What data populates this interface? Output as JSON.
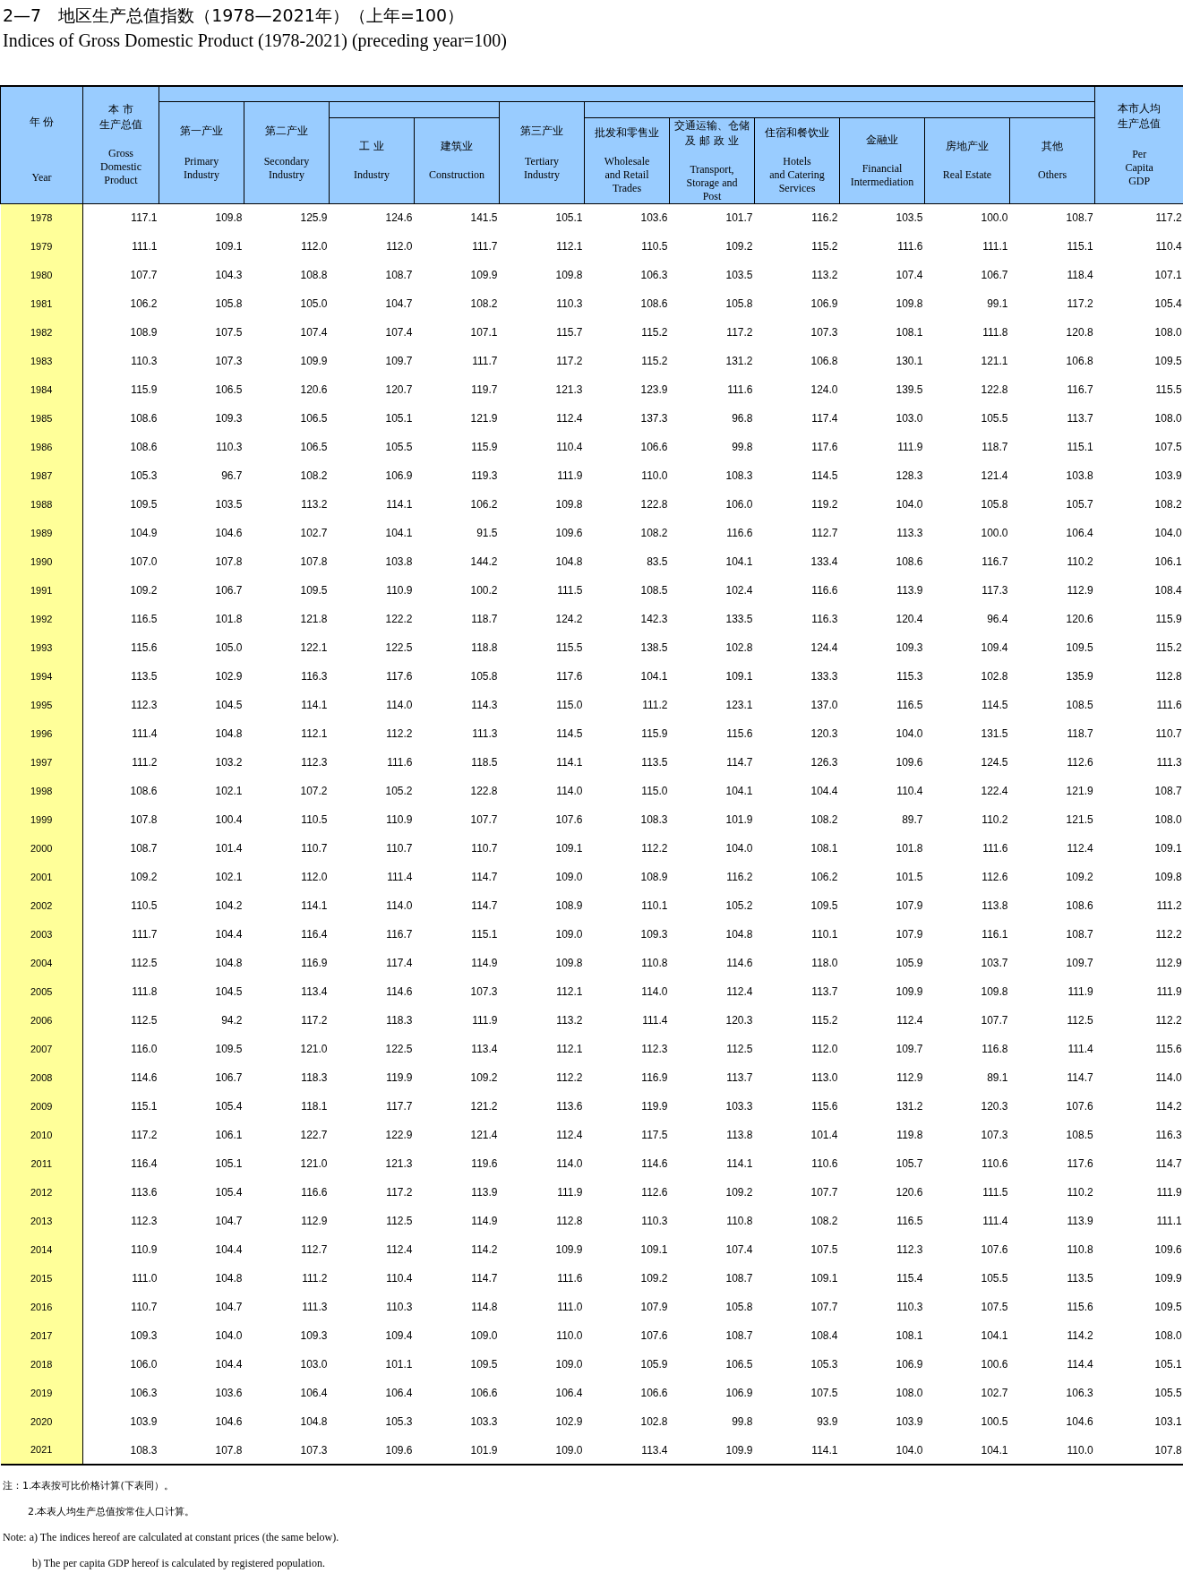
{
  "title": "2—7　地区生产总值指数（1978—2021年）（上年=100）",
  "subtitle": "Indices of Gross Domestic Product (1978-2021) (preceding year=100)",
  "columns": [
    {
      "zh": [
        "年 份"
      ],
      "en": [
        "Year"
      ]
    },
    {
      "zh": [
        "本 市",
        "生产总值"
      ],
      "en": [
        "Gross",
        "Domestic",
        "Product"
      ]
    },
    {
      "zh": [
        "第一产业"
      ],
      "en": [
        "Primary",
        "Industry"
      ]
    },
    {
      "zh": [
        "第二产业"
      ],
      "en": [
        "Secondary",
        "Industry"
      ]
    },
    {
      "zh": [
        "工 业"
      ],
      "en": [
        "Industry"
      ]
    },
    {
      "zh": [
        "建筑业"
      ],
      "en": [
        "Construction"
      ]
    },
    {
      "zh": [
        "第三产业"
      ],
      "en": [
        "Tertiary",
        "Industry"
      ]
    },
    {
      "zh": [
        "批发和零售业"
      ],
      "en": [
        "Wholesale",
        "and Retail",
        "Trades"
      ]
    },
    {
      "zh": [
        "交通运输、仓储",
        "及 邮 政 业"
      ],
      "en": [
        "Transport,",
        "Storage and",
        "Post"
      ]
    },
    {
      "zh": [
        "住宿和餐饮业"
      ],
      "en": [
        "Hotels",
        "and Catering",
        "Services"
      ]
    },
    {
      "zh": [
        "金融业"
      ],
      "en": [
        "Financial",
        "Intermediation"
      ]
    },
    {
      "zh": [
        "房地产业"
      ],
      "en": [
        "Real Estate"
      ]
    },
    {
      "zh": [
        "其他"
      ],
      "en": [
        "Others"
      ]
    },
    {
      "zh": [
        "本市人均",
        "生产总值"
      ],
      "en": [
        "Per",
        "Capita",
        "GDP"
      ]
    }
  ],
  "rows": [
    {
      "year": "1978",
      "values": [
        "117.1",
        "109.8",
        "125.9",
        "124.6",
        "141.5",
        "105.1",
        "103.6",
        "101.7",
        "116.2",
        "103.5",
        "100.0",
        "108.7",
        "117.2"
      ]
    },
    {
      "year": "1979",
      "values": [
        "111.1",
        "109.1",
        "112.0",
        "112.0",
        "111.7",
        "112.1",
        "110.5",
        "109.2",
        "115.2",
        "111.6",
        "111.1",
        "115.1",
        "110.4"
      ]
    },
    {
      "year": "1980",
      "values": [
        "107.7",
        "104.3",
        "108.8",
        "108.7",
        "109.9",
        "109.8",
        "106.3",
        "103.5",
        "113.2",
        "107.4",
        "106.7",
        "118.4",
        "107.1"
      ]
    },
    {
      "year": "1981",
      "values": [
        "106.2",
        "105.8",
        "105.0",
        "104.7",
        "108.2",
        "110.3",
        "108.6",
        "105.8",
        "106.9",
        "109.8",
        "99.1",
        "117.2",
        "105.4"
      ]
    },
    {
      "year": "1982",
      "values": [
        "108.9",
        "107.5",
        "107.4",
        "107.4",
        "107.1",
        "115.7",
        "115.2",
        "117.2",
        "107.3",
        "108.1",
        "111.8",
        "120.8",
        "108.0"
      ]
    },
    {
      "year": "1983",
      "values": [
        "110.3",
        "107.3",
        "109.9",
        "109.7",
        "111.7",
        "117.2",
        "115.2",
        "131.2",
        "106.8",
        "130.1",
        "121.1",
        "106.8",
        "109.5"
      ]
    },
    {
      "year": "1984",
      "values": [
        "115.9",
        "106.5",
        "120.6",
        "120.7",
        "119.7",
        "121.3",
        "123.9",
        "111.6",
        "124.0",
        "139.5",
        "122.8",
        "116.7",
        "115.5"
      ]
    },
    {
      "year": "1985",
      "values": [
        "108.6",
        "109.3",
        "106.5",
        "105.1",
        "121.9",
        "112.4",
        "137.3",
        "96.8",
        "117.4",
        "103.0",
        "105.5",
        "113.7",
        "108.0"
      ]
    },
    {
      "year": "1986",
      "values": [
        "108.6",
        "110.3",
        "106.5",
        "105.5",
        "115.9",
        "110.4",
        "106.6",
        "99.8",
        "117.6",
        "111.9",
        "118.7",
        "115.1",
        "107.5"
      ]
    },
    {
      "year": "1987",
      "values": [
        "105.3",
        "96.7",
        "108.2",
        "106.9",
        "119.3",
        "111.9",
        "110.0",
        "108.3",
        "114.5",
        "128.3",
        "121.4",
        "103.8",
        "103.9"
      ]
    },
    {
      "year": "1988",
      "values": [
        "109.5",
        "103.5",
        "113.2",
        "114.1",
        "106.2",
        "109.8",
        "122.8",
        "106.0",
        "119.2",
        "104.0",
        "105.8",
        "105.7",
        "108.2"
      ]
    },
    {
      "year": "1989",
      "values": [
        "104.9",
        "104.6",
        "102.7",
        "104.1",
        "91.5",
        "109.6",
        "108.2",
        "116.6",
        "112.7",
        "113.3",
        "100.0",
        "106.4",
        "104.0"
      ]
    },
    {
      "year": "1990",
      "values": [
        "107.0",
        "107.8",
        "107.8",
        "103.8",
        "144.2",
        "104.8",
        "83.5",
        "104.1",
        "133.4",
        "108.6",
        "116.7",
        "110.2",
        "106.1"
      ]
    },
    {
      "year": "1991",
      "values": [
        "109.2",
        "106.7",
        "109.5",
        "110.9",
        "100.2",
        "111.5",
        "108.5",
        "102.4",
        "116.6",
        "113.9",
        "117.3",
        "112.9",
        "108.4"
      ]
    },
    {
      "year": "1992",
      "values": [
        "116.5",
        "101.8",
        "121.8",
        "122.2",
        "118.7",
        "124.2",
        "142.3",
        "133.5",
        "116.3",
        "120.4",
        "96.4",
        "120.6",
        "115.9"
      ]
    },
    {
      "year": "1993",
      "values": [
        "115.6",
        "105.0",
        "122.1",
        "122.5",
        "118.8",
        "115.5",
        "138.5",
        "102.8",
        "124.4",
        "109.3",
        "109.4",
        "109.5",
        "115.2"
      ]
    },
    {
      "year": "1994",
      "values": [
        "113.5",
        "102.9",
        "116.3",
        "117.6",
        "105.8",
        "117.6",
        "104.1",
        "109.1",
        "133.3",
        "115.3",
        "102.8",
        "135.9",
        "112.8"
      ]
    },
    {
      "year": "1995",
      "values": [
        "112.3",
        "104.5",
        "114.1",
        "114.0",
        "114.3",
        "115.0",
        "111.2",
        "123.1",
        "137.0",
        "116.5",
        "114.5",
        "108.5",
        "111.6"
      ]
    },
    {
      "year": "1996",
      "values": [
        "111.4",
        "104.8",
        "112.1",
        "112.2",
        "111.3",
        "114.5",
        "115.9",
        "115.6",
        "120.3",
        "104.0",
        "131.5",
        "118.7",
        "110.7"
      ]
    },
    {
      "year": "1997",
      "values": [
        "111.2",
        "103.2",
        "112.3",
        "111.6",
        "118.5",
        "114.1",
        "113.5",
        "114.7",
        "126.3",
        "109.6",
        "124.5",
        "112.6",
        "111.3"
      ]
    },
    {
      "year": "1998",
      "values": [
        "108.6",
        "102.1",
        "107.2",
        "105.2",
        "122.8",
        "114.0",
        "115.0",
        "104.1",
        "104.4",
        "110.4",
        "122.4",
        "121.9",
        "108.7"
      ]
    },
    {
      "year": "1999",
      "values": [
        "107.8",
        "100.4",
        "110.5",
        "110.9",
        "107.7",
        "107.6",
        "108.3",
        "101.9",
        "108.2",
        "89.7",
        "110.2",
        "121.5",
        "108.0"
      ]
    },
    {
      "year": "2000",
      "values": [
        "108.7",
        "101.4",
        "110.7",
        "110.7",
        "110.7",
        "109.1",
        "112.2",
        "104.0",
        "108.1",
        "101.8",
        "111.6",
        "112.4",
        "109.1"
      ]
    },
    {
      "year": "2001",
      "values": [
        "109.2",
        "102.1",
        "112.0",
        "111.4",
        "114.7",
        "109.0",
        "108.9",
        "116.2",
        "106.2",
        "101.5",
        "112.6",
        "109.2",
        "109.8"
      ]
    },
    {
      "year": "2002",
      "values": [
        "110.5",
        "104.2",
        "114.1",
        "114.0",
        "114.7",
        "108.9",
        "110.1",
        "105.2",
        "109.5",
        "107.9",
        "113.8",
        "108.6",
        "111.2"
      ]
    },
    {
      "year": "2003",
      "values": [
        "111.7",
        "104.4",
        "116.4",
        "116.7",
        "115.1",
        "109.0",
        "109.3",
        "104.8",
        "110.1",
        "107.9",
        "116.1",
        "108.7",
        "112.2"
      ]
    },
    {
      "year": "2004",
      "values": [
        "112.5",
        "104.8",
        "116.9",
        "117.4",
        "114.9",
        "109.8",
        "110.8",
        "114.6",
        "118.0",
        "105.9",
        "103.7",
        "109.7",
        "112.9"
      ]
    },
    {
      "year": "2005",
      "values": [
        "111.8",
        "104.5",
        "113.4",
        "114.6",
        "107.3",
        "112.1",
        "114.0",
        "112.4",
        "113.7",
        "109.9",
        "109.8",
        "111.9",
        "111.9"
      ]
    },
    {
      "year": "2006",
      "values": [
        "112.5",
        "94.2",
        "117.2",
        "118.3",
        "111.9",
        "113.2",
        "111.4",
        "120.3",
        "115.2",
        "112.4",
        "107.7",
        "112.5",
        "112.2"
      ]
    },
    {
      "year": "2007",
      "values": [
        "116.0",
        "109.5",
        "121.0",
        "122.5",
        "113.4",
        "112.1",
        "112.3",
        "112.5",
        "112.0",
        "109.7",
        "116.8",
        "111.4",
        "115.6"
      ]
    },
    {
      "year": "2008",
      "values": [
        "114.6",
        "106.7",
        "118.3",
        "119.9",
        "109.2",
        "112.2",
        "116.9",
        "113.7",
        "113.0",
        "112.9",
        "89.1",
        "114.7",
        "114.0"
      ]
    },
    {
      "year": "2009",
      "values": [
        "115.1",
        "105.4",
        "118.1",
        "117.7",
        "121.2",
        "113.6",
        "119.9",
        "103.3",
        "115.6",
        "131.2",
        "120.3",
        "107.6",
        "114.2"
      ]
    },
    {
      "year": "2010",
      "values": [
        "117.2",
        "106.1",
        "122.7",
        "122.9",
        "121.4",
        "112.4",
        "117.5",
        "113.8",
        "101.4",
        "119.8",
        "107.3",
        "108.5",
        "116.3"
      ]
    },
    {
      "year": "2011",
      "values": [
        "116.4",
        "105.1",
        "121.0",
        "121.3",
        "119.6",
        "114.0",
        "114.6",
        "114.1",
        "110.6",
        "105.7",
        "110.6",
        "117.6",
        "114.7"
      ]
    },
    {
      "year": "2012",
      "values": [
        "113.6",
        "105.4",
        "116.6",
        "117.2",
        "113.9",
        "111.9",
        "112.6",
        "109.2",
        "107.7",
        "120.6",
        "111.5",
        "110.2",
        "111.9"
      ]
    },
    {
      "year": "2013",
      "values": [
        "112.3",
        "104.7",
        "112.9",
        "112.5",
        "114.9",
        "112.8",
        "110.3",
        "110.8",
        "108.2",
        "116.5",
        "111.4",
        "113.9",
        "111.1"
      ]
    },
    {
      "year": "2014",
      "values": [
        "110.9",
        "104.4",
        "112.7",
        "112.4",
        "114.2",
        "109.9",
        "109.1",
        "107.4",
        "107.5",
        "112.3",
        "107.6",
        "110.8",
        "109.6"
      ]
    },
    {
      "year": "2015",
      "values": [
        "111.0",
        "104.8",
        "111.2",
        "110.4",
        "114.7",
        "111.6",
        "109.2",
        "108.7",
        "109.1",
        "115.4",
        "105.5",
        "113.5",
        "109.9"
      ]
    },
    {
      "year": "2016",
      "values": [
        "110.7",
        "104.7",
        "111.3",
        "110.3",
        "114.8",
        "111.0",
        "107.9",
        "105.8",
        "107.7",
        "110.3",
        "107.5",
        "115.6",
        "109.5"
      ]
    },
    {
      "year": "2017",
      "values": [
        "109.3",
        "104.0",
        "109.3",
        "109.4",
        "109.0",
        "110.0",
        "107.6",
        "108.7",
        "108.4",
        "108.1",
        "104.1",
        "114.2",
        "108.0"
      ]
    },
    {
      "year": "2018",
      "values": [
        "106.0",
        "104.4",
        "103.0",
        "101.1",
        "109.5",
        "109.0",
        "105.9",
        "106.5",
        "105.3",
        "106.9",
        "100.6",
        "114.4",
        "105.1"
      ]
    },
    {
      "year": "2019",
      "values": [
        "106.3",
        "103.6",
        "106.4",
        "106.4",
        "106.6",
        "106.4",
        "106.6",
        "106.9",
        "107.5",
        "108.0",
        "102.7",
        "106.3",
        "105.5"
      ]
    },
    {
      "year": "2020",
      "values": [
        "103.9",
        "104.6",
        "104.8",
        "105.3",
        "103.3",
        "102.9",
        "102.8",
        "99.8",
        "93.9",
        "103.9",
        "100.5",
        "104.6",
        "103.1"
      ]
    },
    {
      "year": "2021",
      "values": [
        "108.3",
        "107.8",
        "107.3",
        "109.6",
        "101.9",
        "109.0",
        "113.4",
        "109.9",
        "114.1",
        "104.0",
        "104.1",
        "110.0",
        "107.8"
      ]
    }
  ],
  "notes_zh": [
    "注：1.本表按可比价格计算(下表同）。",
    "2.本表人均生产总值按常住人口计算。"
  ],
  "notes_en": [
    "Note: a) The indices hereof are calculated at constant prices (the same below).",
    "b) The per capita GDP hereof is calculated by registered population."
  ]
}
